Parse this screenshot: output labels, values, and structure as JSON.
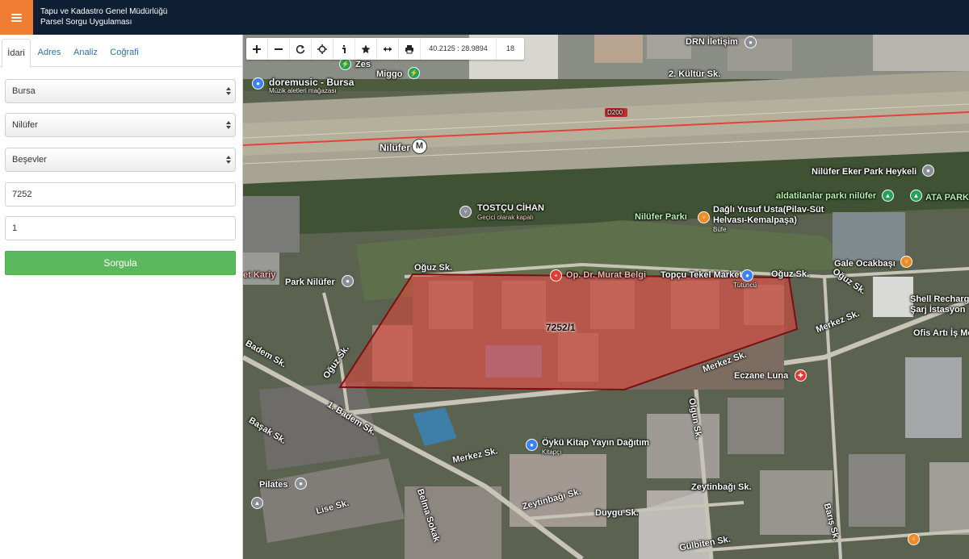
{
  "header": {
    "title_line1": "Tapu ve Kadastro Genel Müdürlüğü",
    "title_line2": "Parsel Sorgu Uygulaması",
    "menu_icon": "hamburger-menu-icon",
    "colors": {
      "header_bg": "#0e1f33",
      "menu_bg": "#ef7d32"
    }
  },
  "tabs": [
    {
      "label": "İdari",
      "active": true
    },
    {
      "label": "Adres",
      "active": false
    },
    {
      "label": "Analiz",
      "active": false
    },
    {
      "label": "Coğrafi",
      "active": false
    }
  ],
  "form": {
    "il": "Bursa",
    "ilce": "Nilüfer",
    "mahalle": "Beşevler",
    "ada": "7252",
    "parsel": "1",
    "submit_label": "Sorgula",
    "submit_color": "#5cb85c"
  },
  "toolbar": {
    "coordinates": "40.2125 : 28.9894",
    "zoom_level": "18",
    "icons": [
      "zoom-in-icon",
      "zoom-out-icon",
      "refresh-icon",
      "locate-icon",
      "info-icon",
      "star-icon",
      "measure-icon",
      "print-icon"
    ]
  },
  "map": {
    "parcel_label": "7252/1",
    "parcel_color": "#e8453c",
    "highway_shield": "D200",
    "labels": {
      "drn": "DRN İletişim",
      "kultur": "2. Kültür Sk.",
      "zes": "Zes",
      "miggo": "Miggo",
      "doremusic": "doremusic - Bursa",
      "doremusic_sub": "Müzik aletleri mağazası",
      "nilufer_station": "Nilüfer",
      "metro": "M",
      "eker_park": "Nilüfer Eker Park Heykeli",
      "aldatilanlar": "aldatilanlar parkı nilüfer",
      "ata_park": "ATA PARK",
      "tostcu": "TOSTÇU CİHAN",
      "tostcu_sub": "Geçici olarak kapalı",
      "nilufer_parki": "Nilüfer Parkı",
      "dagli": "Dağlı Yusuf Usta(Pilav-Süt",
      "dagli2": "Helvası-Kemalpaşa)",
      "dagli_sub": "Büfe",
      "gale": "Gale Ocakbaşı",
      "shell": "Shell Recharg",
      "shell2": "Şarj İstasyon",
      "ofis": "Ofis Artı İş Merk",
      "oguz1": "Oğuz Sk.",
      "oguz2": "Oğuz Sk.",
      "oguz3": "Oğuz Sk.",
      "oguz4": "Oğuz Sk.",
      "murat": "Op. Dr. Murat Belgi",
      "topcu": "Topçu Tekel Market",
      "topcu_sub": "Tütüncü",
      "merkez1": "Merkez Sk.",
      "merkez2": "Merkez Sk.",
      "merkez3": "Merkez Sk.",
      "park_nilufer": "Park Nilüfer",
      "kariyer": "et Kariy",
      "bademsk": "Badem Sk.",
      "badem1": "1. Badem Sk.",
      "basak": "Başak Sk.",
      "eczane": "Eczane Luna",
      "olgun": "Olgun Sk.",
      "oyku": "Öykü Kitap Yayın Dağıtım",
      "oyku_sub": "Kitapçı",
      "zeytinbagi1": "Zeytinbağı Sk.",
      "zeytinbagi2": "Zeytinbağı Sk.",
      "duygu": "Duygu Sk.",
      "pilates": "Pilates",
      "lise": "Lise Sk.",
      "belma": "Belma Sokak",
      "baris": "Barış Sk.",
      "gulbiten": "Gülbiten Sk."
    }
  }
}
